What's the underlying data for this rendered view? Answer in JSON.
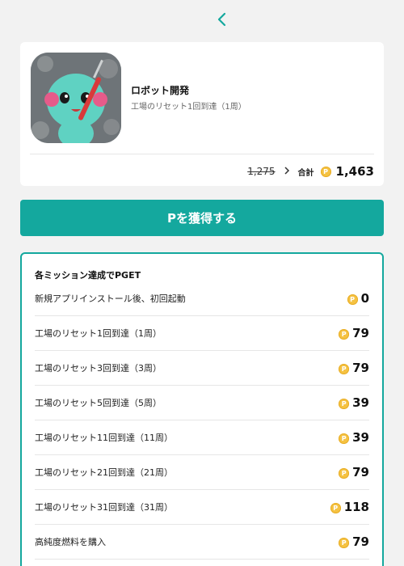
{
  "nav": {
    "back_icon": "chevron-left-icon"
  },
  "app": {
    "name": "ロボット開発",
    "subtitle": "工場のリセット1回到達（1周）",
    "old_price": "1,275",
    "total_label": "合計",
    "total_value": "1,463",
    "coin_symbol": "P"
  },
  "earn_button": {
    "label": "Pを獲得する"
  },
  "missions": {
    "title": "各ミッション達成でPGET",
    "items": [
      {
        "label": "新規アプリインストール後、初回起動",
        "points": "0"
      },
      {
        "label": "工場のリセット1回到達（1周）",
        "points": "79"
      },
      {
        "label": "工場のリセット3回到達（3周）",
        "points": "79"
      },
      {
        "label": "工場のリセット5回到達（5周）",
        "points": "39"
      },
      {
        "label": "工場のリセット11回到達（11周）",
        "points": "39"
      },
      {
        "label": "工場のリセット21回到達（21周）",
        "points": "79"
      },
      {
        "label": "工場のリセット31回到達（31周）",
        "points": "118"
      },
      {
        "label": "高純度燃料を購入",
        "points": "79"
      }
    ]
  },
  "colors": {
    "accent": "#14a89e",
    "coin": "#f5c242",
    "background": "#f2f2f2"
  }
}
